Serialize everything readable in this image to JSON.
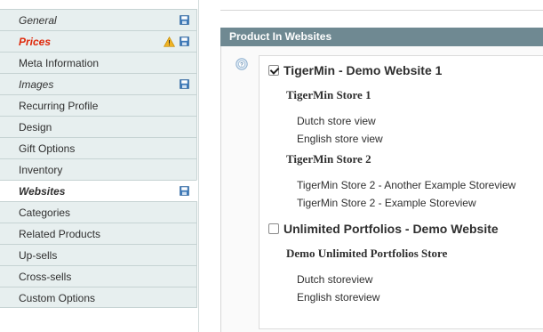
{
  "sidebar": {
    "tabs": [
      {
        "label": "General",
        "style": "italic",
        "icons": [
          "save-icon"
        ]
      },
      {
        "label": "Prices",
        "style": "error",
        "icons": [
          "warning-icon",
          "save-icon"
        ]
      },
      {
        "label": "Meta Information",
        "style": "normal",
        "icons": []
      },
      {
        "label": "Images",
        "style": "italic",
        "icons": [
          "save-icon"
        ]
      },
      {
        "label": "Recurring Profile",
        "style": "normal",
        "icons": []
      },
      {
        "label": "Design",
        "style": "normal",
        "icons": []
      },
      {
        "label": "Gift Options",
        "style": "normal",
        "icons": []
      },
      {
        "label": "Inventory",
        "style": "normal",
        "icons": []
      },
      {
        "label": "Websites",
        "style": "active",
        "icons": [
          "save-icon"
        ]
      },
      {
        "label": "Categories",
        "style": "normal",
        "icons": []
      },
      {
        "label": "Related Products",
        "style": "normal",
        "icons": []
      },
      {
        "label": "Up-sells",
        "style": "normal",
        "icons": []
      },
      {
        "label": "Cross-sells",
        "style": "normal",
        "icons": []
      },
      {
        "label": "Custom Options",
        "style": "normal",
        "icons": []
      }
    ]
  },
  "section": {
    "title": "Product In Websites",
    "websites": [
      {
        "name": "TigerMin - Demo Website 1",
        "checked": true,
        "stores": [
          {
            "name": "TigerMin Store 1",
            "views": [
              "Dutch store view",
              "English store view"
            ]
          },
          {
            "name": "TigerMin Store 2",
            "views": [
              "TigerMin Store 2 - Another Example Storeview",
              "TigerMin Store 2 - Example Storeview"
            ]
          }
        ]
      },
      {
        "name": "Unlimited Portfolios - Demo Website",
        "checked": false,
        "stores": [
          {
            "name": "Demo Unlimited Portfolios Store",
            "views": [
              "Dutch storeview",
              "English storeview"
            ]
          }
        ]
      }
    ]
  },
  "colors": {
    "header_bg": "#6f8992",
    "tab_bg": "#e7efef",
    "error_text": "#df280a",
    "save_icon": "#3d79b8",
    "warning_icon": "#f0b323"
  }
}
